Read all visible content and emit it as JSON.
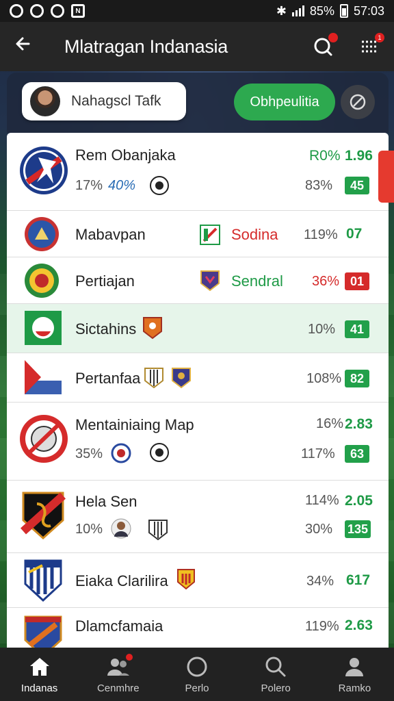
{
  "status_bar": {
    "battery": "85%",
    "time": "57:03",
    "notification_icons": [
      "circle-icon",
      "circle-icon",
      "circle-icon",
      "n-icon"
    ]
  },
  "app_bar": {
    "title": "Mlatragan Indanasia",
    "notification_badge": "1"
  },
  "controls": {
    "user_name": "Nahagscl Tafk",
    "primary_button": "Obhpeulitia"
  },
  "rows": [
    {
      "name": "Rem Obanjaka",
      "pct_left": "17%",
      "sub": "40%",
      "value_pct": "R0%",
      "value": "1.96",
      "pct_right": "83%",
      "badge": "45",
      "badge_color": "green"
    },
    {
      "name": "Mabavpan",
      "tag": "Sodina",
      "tag_color": "#d52b2b",
      "pct_right": "119%",
      "value": "07"
    },
    {
      "name": "Pertiajan",
      "tag": "Sendral",
      "tag_color": "#1e9a46",
      "pct_right": "36%",
      "badge": "01",
      "badge_color": "red"
    },
    {
      "name": "Sictahins",
      "pct_right": "10%",
      "badge": "41",
      "badge_color": "green",
      "highlighted": true
    },
    {
      "name": "Pertanfaa",
      "pct_right": "108%",
      "badge": "82",
      "badge_color": "green"
    },
    {
      "name": "Mentainiaing Map",
      "pct_left": "35%",
      "value_pct": "16%",
      "value": "2.83",
      "pct_right": "117%",
      "badge": "63",
      "badge_color": "green"
    },
    {
      "name": "Hela Sen",
      "pct_left": "10%",
      "value_pct": "114%",
      "value": "2.05",
      "pct_right": "30%",
      "badge": "135",
      "badge_color": "green"
    },
    {
      "name": "Eiaka Clarilira",
      "pct_right": "34%",
      "value": "617"
    },
    {
      "name": "Dlamcfamaia",
      "value_pct": "119%",
      "value": "2.63"
    }
  ],
  "bottom_nav": [
    {
      "label": "Indanas",
      "icon": "home-icon",
      "active": true
    },
    {
      "label": "Cenmhre",
      "icon": "people-icon"
    },
    {
      "label": "Perlo",
      "icon": "circle-icon"
    },
    {
      "label": "Polero",
      "icon": "search-icon"
    },
    {
      "label": "Ramko",
      "icon": "person-icon"
    }
  ],
  "colors": {
    "accent_green": "#2da94f",
    "alert_red": "#d52b2b",
    "app_bar": "#262626"
  }
}
